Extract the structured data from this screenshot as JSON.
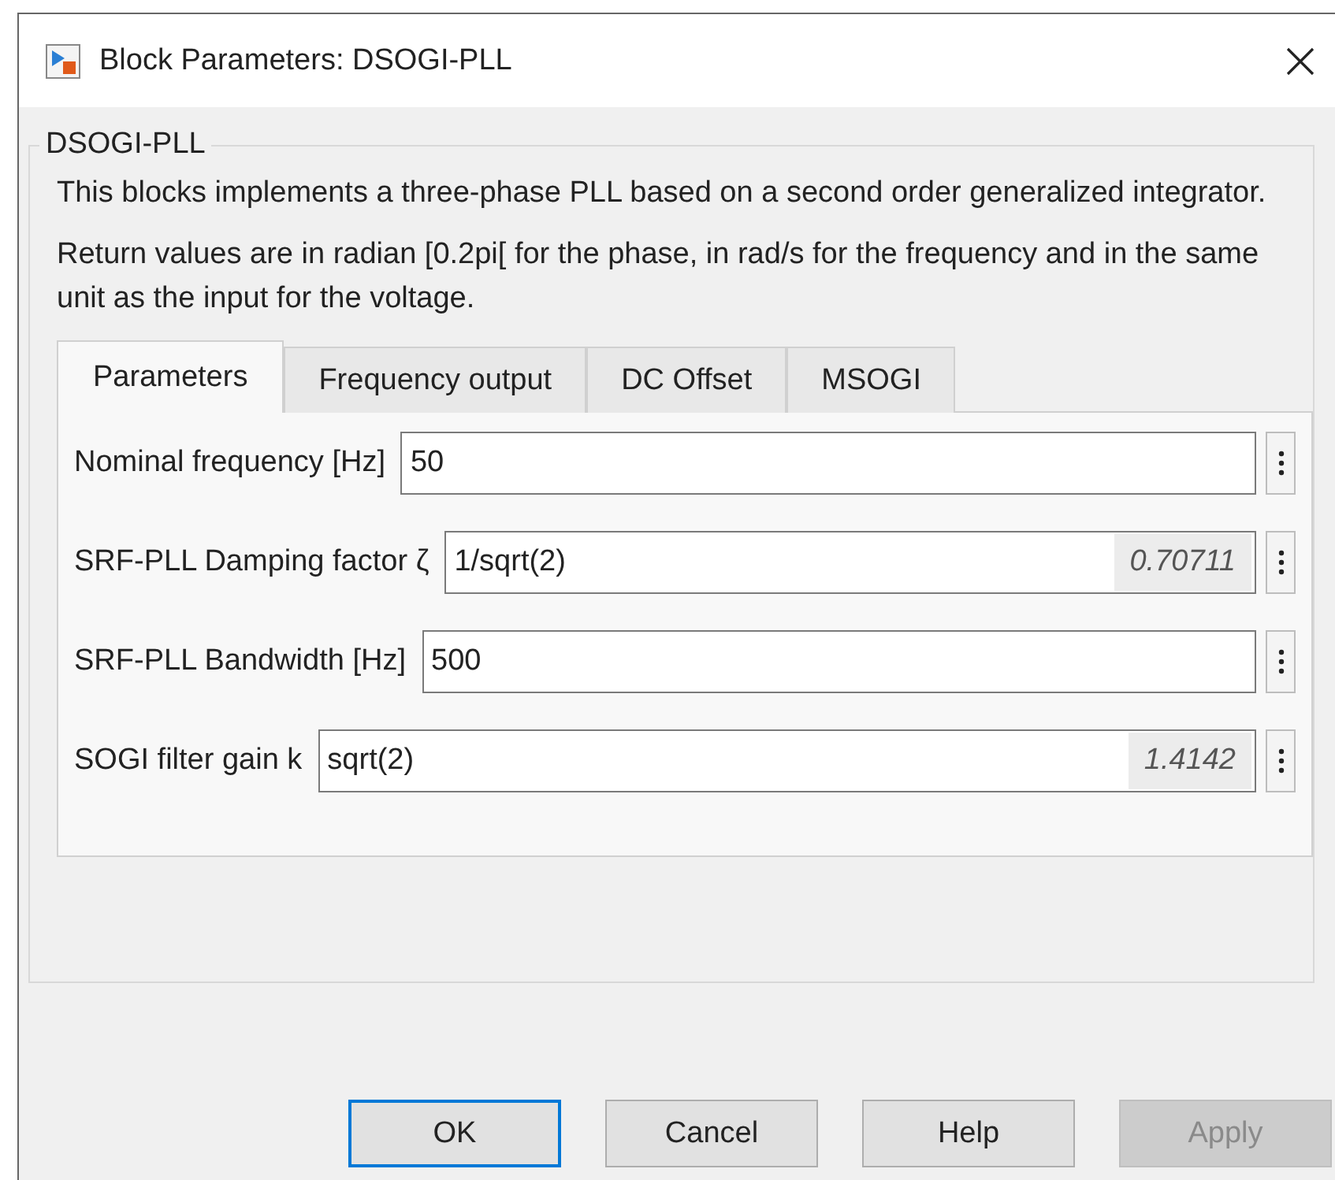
{
  "window": {
    "title": "Block Parameters: DSOGI-PLL"
  },
  "group": {
    "legend": "DSOGI-PLL",
    "paragraphs": [
      "This blocks implements a three-phase PLL based on a second order generalized integrator.",
      "Return values are in radian [0.2pi[ for the phase, in rad/s for the frequency and in the same unit as the input for the voltage."
    ]
  },
  "tabs": [
    {
      "label": "Parameters",
      "selected": true
    },
    {
      "label": "Frequency output",
      "selected": false
    },
    {
      "label": "DC Offset",
      "selected": false
    },
    {
      "label": "MSOGI",
      "selected": false
    }
  ],
  "parameters": [
    {
      "label": "Nominal frequency [Hz]",
      "value": "50"
    },
    {
      "label": "SRF-PLL Damping factor ζ",
      "value": "1/sqrt(2)",
      "evaluated": "0.70711"
    },
    {
      "label": "SRF-PLL Bandwidth [Hz]",
      "value": "500"
    },
    {
      "label": "SOGI filter gain k",
      "value": "sqrt(2)",
      "evaluated": "1.4142"
    }
  ],
  "buttons": [
    {
      "label": "OK",
      "focused": true,
      "disabled": false
    },
    {
      "label": "Cancel",
      "focused": false,
      "disabled": false
    },
    {
      "label": "Help",
      "focused": false,
      "disabled": false
    },
    {
      "label": "Apply",
      "focused": false,
      "disabled": true
    }
  ]
}
